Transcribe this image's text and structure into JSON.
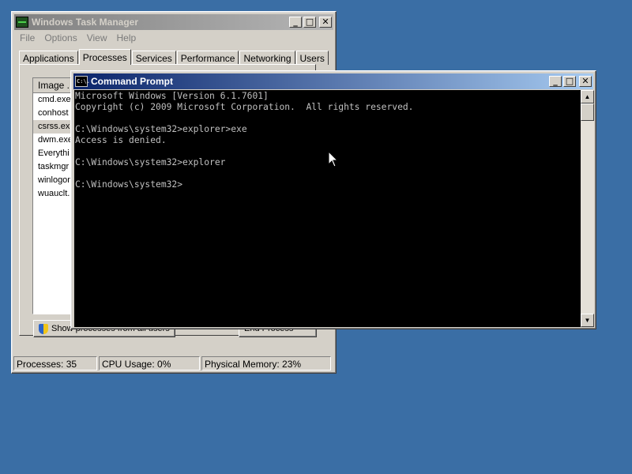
{
  "taskmanager": {
    "title": "Windows Task Manager",
    "menu": [
      "File",
      "Options",
      "View",
      "Help"
    ],
    "tabs": [
      "Applications",
      "Processes",
      "Services",
      "Performance",
      "Networking",
      "Users"
    ],
    "active_tab": "Processes",
    "column_header": "Image ...",
    "processes": [
      "cmd.exe",
      "conhost",
      "csrss.ex",
      "dwm.exe",
      "Everythi",
      "taskmgr",
      "winlogon",
      "wuauclt."
    ],
    "show_all_button": "Show processes from all users",
    "end_process_button": "End Process",
    "status": {
      "processes": "Processes: 35",
      "cpu": "CPU Usage: 0%",
      "memory": "Physical Memory: 23%"
    }
  },
  "cmd": {
    "title": "Command Prompt",
    "icon_text": "C:\\.",
    "lines": [
      "Microsoft Windows [Version 6.1.7601]",
      "Copyright (c) 2009 Microsoft Corporation.  All rights reserved.",
      "",
      "C:\\Windows\\system32>explorer>exe",
      "Access is denied.",
      "",
      "C:\\Windows\\system32>explorer",
      "",
      "C:\\Windows\\system32>"
    ]
  },
  "window_buttons": {
    "minimize": "_",
    "maximize": "□",
    "close": "✕"
  },
  "colors": {
    "desktop": "#3a6ea5",
    "titlebar_active": "#0a246a",
    "titlebar_inactive": "#808080",
    "console_bg": "#000000",
    "console_text": "#c0c0c0"
  }
}
